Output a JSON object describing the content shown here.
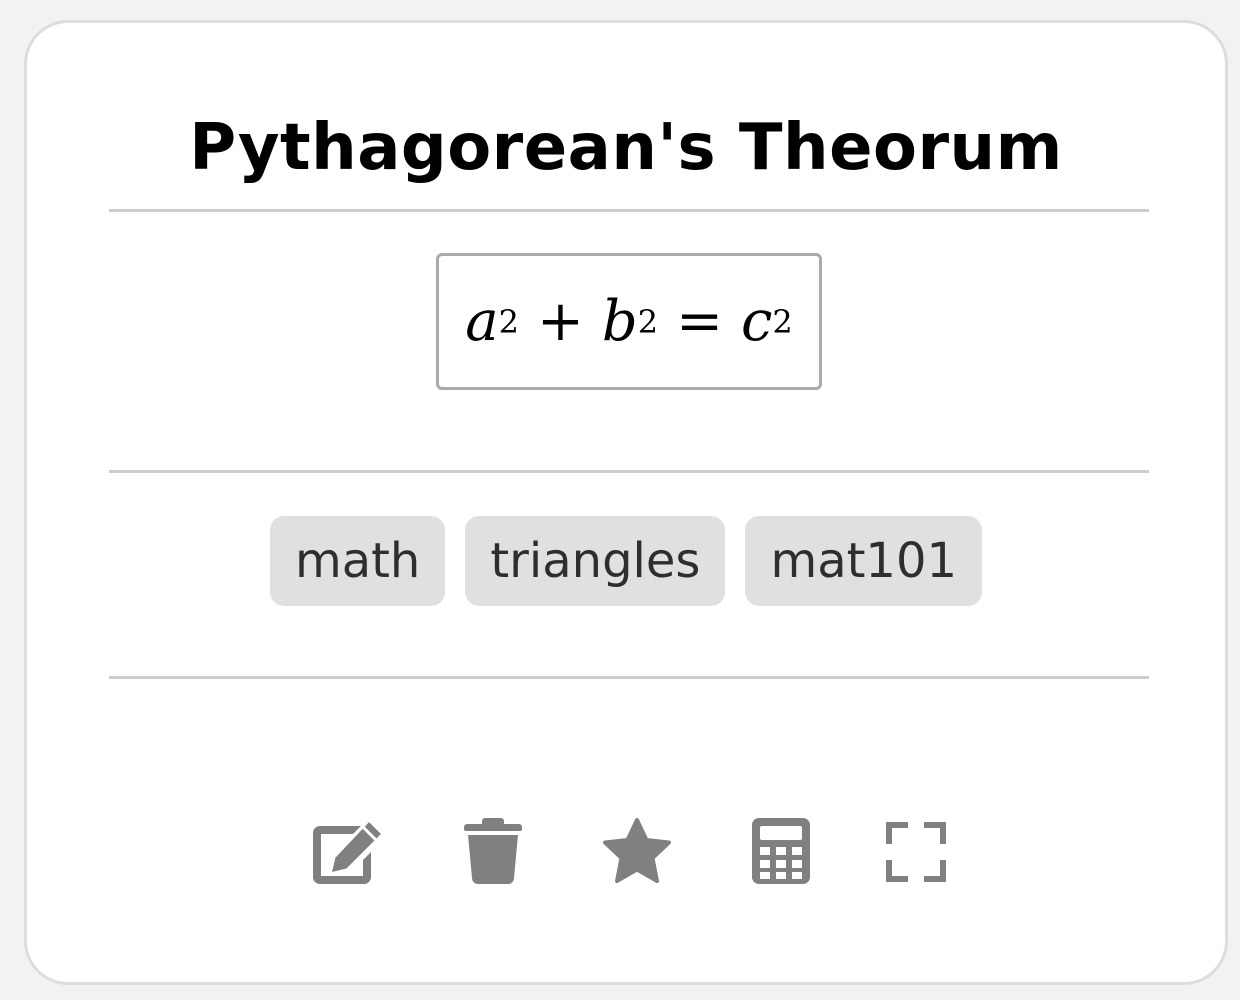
{
  "card": {
    "title": "Pythagorean's Theorum",
    "formula": {
      "terms": [
        {
          "var": "a",
          "exp": "2"
        },
        {
          "op": "+"
        },
        {
          "var": "b",
          "exp": "2"
        },
        {
          "op": "="
        },
        {
          "var": "c",
          "exp": "2"
        }
      ]
    },
    "tags": [
      "math",
      "triangles",
      "mat101"
    ],
    "actions": [
      {
        "name": "edit-button",
        "icon": "edit-icon"
      },
      {
        "name": "delete-button",
        "icon": "trash-icon"
      },
      {
        "name": "favorite-button",
        "icon": "star-icon"
      },
      {
        "name": "calculator-button",
        "icon": "calculator-icon"
      },
      {
        "name": "fullscreen-button",
        "icon": "expand-icon"
      }
    ]
  },
  "colors": {
    "icon": "#808080",
    "tag_bg": "#e0e0e0",
    "tag_text": "#2e2e2e",
    "divider": "#cccccc",
    "card_border": "#dddddd"
  }
}
